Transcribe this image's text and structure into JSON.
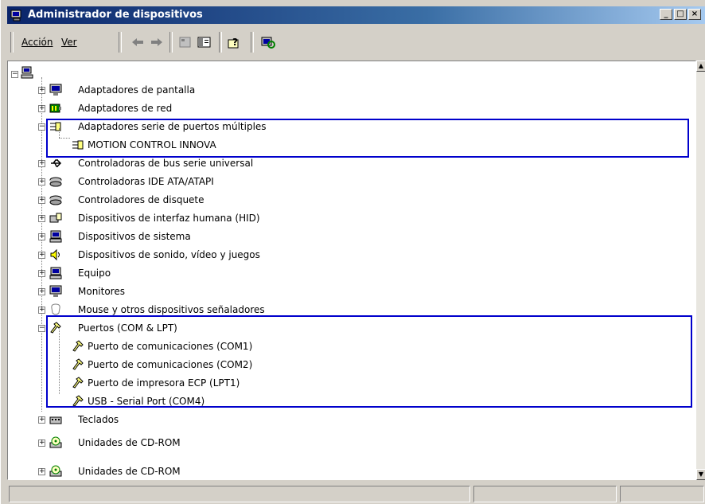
{
  "window": {
    "title": "Administrador de dispositivos"
  },
  "menu": {
    "accion": "Acción",
    "ver": "Ver"
  },
  "tree": {
    "categories": [
      {
        "label": "Adaptadores de pantalla",
        "icon": "display-adapter-icon"
      },
      {
        "label": "Adaptadores de red",
        "icon": "network-adapter-icon"
      },
      {
        "label": "Adaptadores serie de puertos múltiples",
        "icon": "multiport-serial-icon",
        "children": [
          "MOTION CONTROL INNOVA"
        ]
      },
      {
        "label": "Controladoras de bus serie universal",
        "icon": "usb-icon"
      },
      {
        "label": "Controladoras IDE ATA/ATAPI",
        "icon": "ide-controller-icon"
      },
      {
        "label": "Controladores de disquete",
        "icon": "floppy-controller-icon"
      },
      {
        "label": "Dispositivos de interfaz humana (HID)",
        "icon": "hid-icon"
      },
      {
        "label": "Dispositivos de sistema",
        "icon": "system-device-icon"
      },
      {
        "label": "Dispositivos de sonido, vídeo y juegos",
        "icon": "sound-icon"
      },
      {
        "label": "Equipo",
        "icon": "computer-icon"
      },
      {
        "label": "Monitores",
        "icon": "monitor-icon"
      },
      {
        "label": "Mouse y otros dispositivos señaladores",
        "icon": "mouse-icon"
      },
      {
        "label": "Puertos (COM & LPT)",
        "icon": "port-icon",
        "children": [
          "Puerto de comunicaciones (COM1)",
          "Puerto de comunicaciones (COM2)",
          "Puerto de impresora ECP (LPT1)",
          "USB - Serial Port (COM4)"
        ]
      },
      {
        "label": "Teclados",
        "icon": "keyboard-icon"
      },
      {
        "label": "Unidades de CD-ROM",
        "icon": "cdrom-icon"
      },
      {
        "label": "Unidades de CD-ROM",
        "icon": "cdrom-icon"
      }
    ]
  },
  "colors": {
    "titlebar": "#0a246a",
    "highlight": "#0000cc",
    "chrome": "#d4d0c8"
  }
}
